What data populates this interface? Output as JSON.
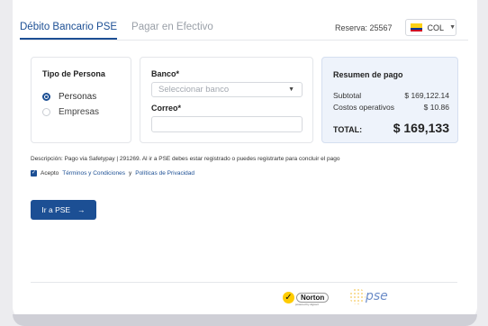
{
  "tabs": [
    {
      "label": "Débito Bancario PSE",
      "active": true
    },
    {
      "label": "Pagar en Efectivo",
      "active": false
    }
  ],
  "reserva": "Reserva: 25567",
  "currency": {
    "code": "COL",
    "flag_icon": "colombia-flag-icon"
  },
  "persona": {
    "title": "Tipo de Persona",
    "options": [
      {
        "label": "Personas",
        "checked": true
      },
      {
        "label": "Empresas",
        "checked": false
      }
    ]
  },
  "form": {
    "banco_label": "Banco*",
    "banco_placeholder": "Seleccionar banco",
    "correo_label": "Correo*",
    "correo_value": ""
  },
  "resumen": {
    "title": "Resumen de pago",
    "subtotal_label": "Subtotal",
    "subtotal_value": "$ 169,122.14",
    "costos_label": "Costos operativos",
    "costos_value": "$ 10.86",
    "total_label": "TOTAL:",
    "total_value": "$ 169,133"
  },
  "description": "Descripción: Pago via Safetypay | 291269. Al ir a PSE debes estar registrado o puedes registrarte para concluir el pago",
  "terms": {
    "checked": true,
    "prefix": "Acepto",
    "terms_link": "Términos y Condiciones",
    "connector": "y",
    "privacy_link": "Políticas de Privacidad"
  },
  "button": {
    "label": "Ir a PSE",
    "icon": "arrow-right-icon"
  },
  "footer": {
    "norton_name": "Norton",
    "norton_sub": "powered by digicert",
    "pse_text": "pse"
  },
  "colors": {
    "primary": "#1c4f94",
    "summary_bg": "#eef3fb"
  }
}
